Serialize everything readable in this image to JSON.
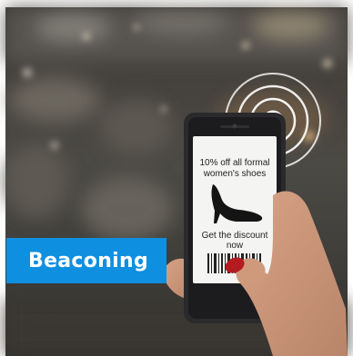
{
  "banner": {
    "label": "Beaconing"
  },
  "phone_ad": {
    "headline_line1": "10% off all formal",
    "headline_line2": "women's shoes",
    "cta_line1": "Get the discount",
    "cta_line2": "now"
  },
  "colors": {
    "tag_blue": "#0f8fe0",
    "screen": "#f4f4f2",
    "phone_body": "#2a2a2c"
  },
  "icons": [
    "beacon-signal-icon",
    "high-heel-shoe-icon",
    "barcode-icon"
  ]
}
